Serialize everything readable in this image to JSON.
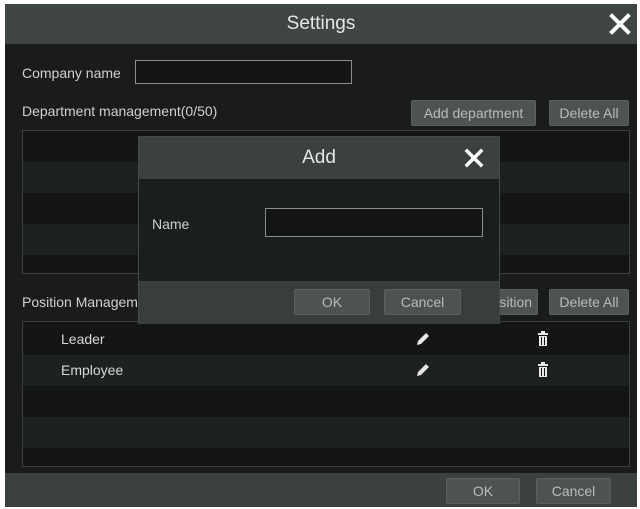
{
  "window": {
    "title": "Settings",
    "close_icon": "close-icon"
  },
  "company": {
    "label": "Company name",
    "value": ""
  },
  "department": {
    "label": "Department management(0/50)",
    "add_label": "Add department",
    "delete_all_label": "Delete All",
    "rows": []
  },
  "position": {
    "label": "Position Management",
    "add_label": "Add position",
    "delete_all_label": "Delete All",
    "rows": [
      {
        "name": "Leader",
        "edit_icon": "pencil-icon",
        "delete_icon": "trash-icon"
      },
      {
        "name": "Employee",
        "edit_icon": "pencil-icon",
        "delete_icon": "trash-icon"
      }
    ]
  },
  "footer": {
    "ok_label": "OK",
    "cancel_label": "Cancel"
  },
  "modal": {
    "title": "Add",
    "name_label": "Name",
    "name_value": "",
    "ok_label": "OK",
    "cancel_label": "Cancel",
    "close_icon": "close-icon"
  },
  "colors": {
    "background": "#1a1c1c",
    "header": "#3f4444",
    "button": "#4d5252",
    "text": "#d6d6d6"
  }
}
